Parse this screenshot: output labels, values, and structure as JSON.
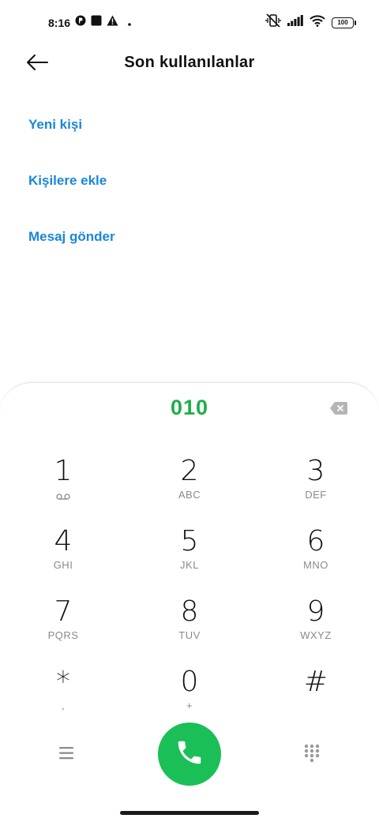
{
  "status_bar": {
    "time": "8:16",
    "battery": "100",
    "icons": [
      "circle-p-icon",
      "square-icon",
      "warning-icon",
      "dot-icon",
      "vibrate-off-icon",
      "signal-icon",
      "wifi-icon",
      "battery-icon"
    ]
  },
  "header": {
    "title": "Son kullanılanlar",
    "back_icon": "arrow-left-icon"
  },
  "actions": {
    "new_contact": "Yeni kişi",
    "add_to_contacts": "Kişilere ekle",
    "send_message": "Mesaj gönder"
  },
  "dialer": {
    "number": "010",
    "accent_color": "#1fae4b",
    "call_color": "#1bbf57",
    "keys": [
      {
        "num": "1",
        "sub": "",
        "sub_icon": "voicemail-icon"
      },
      {
        "num": "2",
        "sub": "ABC"
      },
      {
        "num": "3",
        "sub": "DEF"
      },
      {
        "num": "4",
        "sub": "GHI"
      },
      {
        "num": "5",
        "sub": "JKL"
      },
      {
        "num": "6",
        "sub": "MNO"
      },
      {
        "num": "7",
        "sub": "PQRS"
      },
      {
        "num": "8",
        "sub": "TUV"
      },
      {
        "num": "9",
        "sub": "WXYZ"
      },
      {
        "num": "*",
        "sub": ","
      },
      {
        "num": "0",
        "sub": "+"
      },
      {
        "num": "#",
        "sub": ""
      }
    ]
  }
}
